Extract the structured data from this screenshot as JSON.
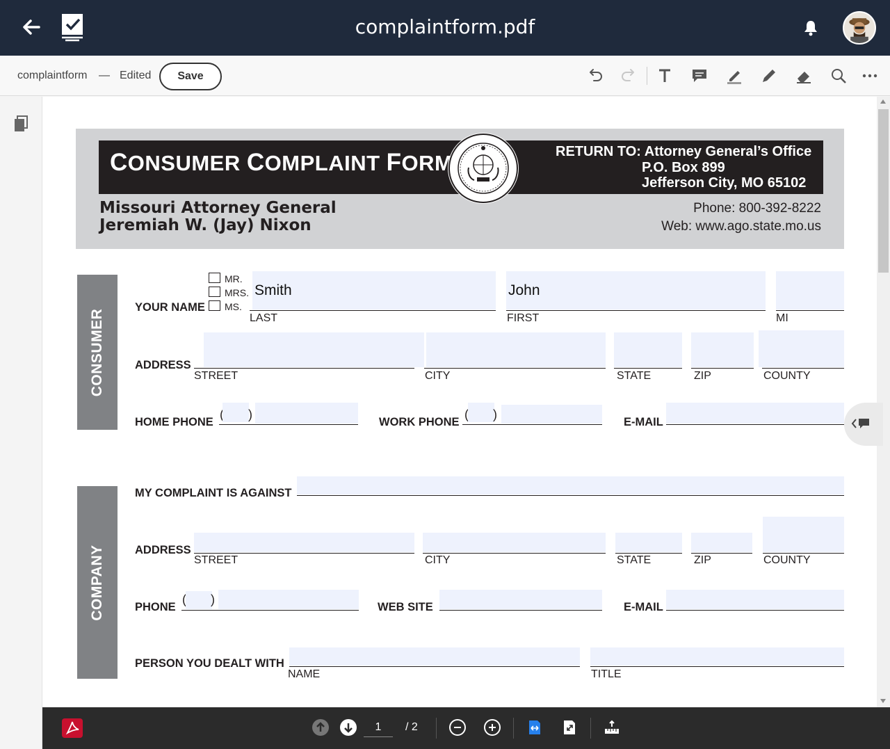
{
  "app": {
    "title": "complaintform.pdf",
    "icons": {
      "back": "back-arrow-icon",
      "app": "checklist-app-icon",
      "bell": "bell-icon",
      "avatar": "user-avatar"
    }
  },
  "toolbar": {
    "file_name": "complaintform",
    "separator": "—",
    "status": "Edited",
    "save_label": "Save",
    "tools": [
      "undo-icon",
      "redo-icon",
      "text-tool-icon",
      "comment-tool-icon",
      "highlight-tool-icon",
      "draw-tool-icon",
      "eraser-tool-icon",
      "search-icon",
      "more-icon"
    ]
  },
  "form": {
    "header": {
      "title_first": "C",
      "title_rest": "ONSUMER ",
      "title_first2": "C",
      "title_rest2": "OMPLAINT ",
      "title_first3": "F",
      "title_rest3": "ORM",
      "return_line1": "RETURN TO: Attorney General’s Office",
      "return_line2": "P.O. Box 899",
      "return_line3": "Jefferson City, MO 65102",
      "ag_line1": "Missouri Attorney General",
      "ag_line2": "Jeremiah W. (Jay) Nixon",
      "phone": "Phone: 800-392-8222",
      "web": "Web: www.ago.state.mo.us"
    },
    "consumer": {
      "tab": "CONSUMER",
      "your_name": "YOUR NAME",
      "title_options": [
        "MR.",
        "MRS.",
        "MS."
      ],
      "last_label": "LAST",
      "first_label": "FIRST",
      "mi_label": "MI",
      "last_value": "Smith",
      "first_value": "John",
      "mi_value": "",
      "address": "ADDRESS",
      "street": "STREET",
      "city": "CITY",
      "state": "STATE",
      "zip": "ZIP",
      "county": "COUNTY",
      "home_phone": "HOME PHONE",
      "work_phone": "WORK PHONE",
      "email": "E-MAIL"
    },
    "company": {
      "tab": "COMPANY",
      "complaint_against": "MY COMPLAINT IS AGAINST",
      "address": "ADDRESS",
      "street": "STREET",
      "city": "CITY",
      "state": "STATE",
      "zip": "ZIP",
      "county": "COUNTY",
      "phone": "PHONE",
      "web_site": "WEB SITE",
      "email": "E-MAIL",
      "person": "PERSON YOU DEALT WITH",
      "name": "NAME",
      "title": "TITLE"
    }
  },
  "bottombar": {
    "page_current": "1",
    "page_total": "/ 2"
  },
  "colors": {
    "topbar": "#1f2a3c",
    "field_fill": "#eef2fd",
    "section_tab": "#808285",
    "acrobat_red": "#c8102e",
    "accent_blue": "#2680eb"
  }
}
